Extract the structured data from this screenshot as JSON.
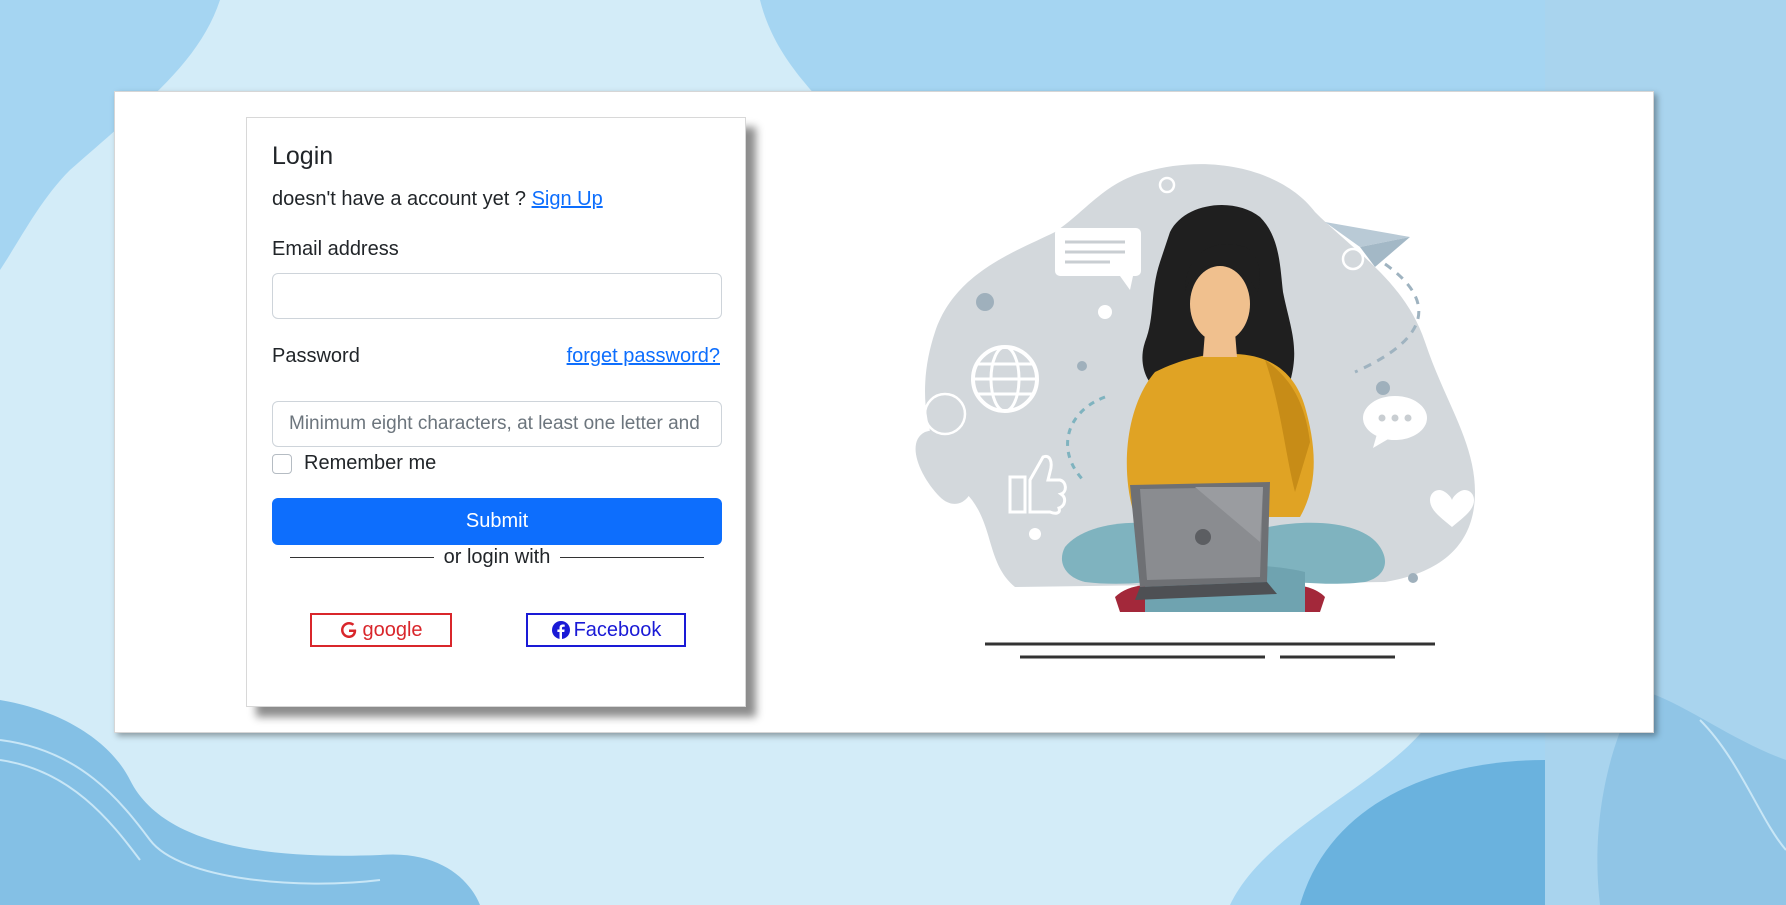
{
  "login": {
    "title": "Login",
    "signup_prompt": "doesn't have a account yet ?",
    "signup_link": "Sign Up",
    "email_label": "Email address",
    "email_value": "",
    "password_label": "Password",
    "forget_link": "forget password?",
    "password_placeholder": "Minimum eight characters, at least one letter and one number",
    "remember_label": "Remember me",
    "remember_checked": false,
    "submit_label": "Submit",
    "divider_text": "or login with",
    "google_label": "google",
    "facebook_label": "Facebook"
  },
  "colors": {
    "primary": "#0d6efd",
    "google": "#d9262b",
    "facebook": "#1a1ad6",
    "background": "#d3ecf8"
  },
  "icons": [
    "google-icon",
    "facebook-icon"
  ]
}
